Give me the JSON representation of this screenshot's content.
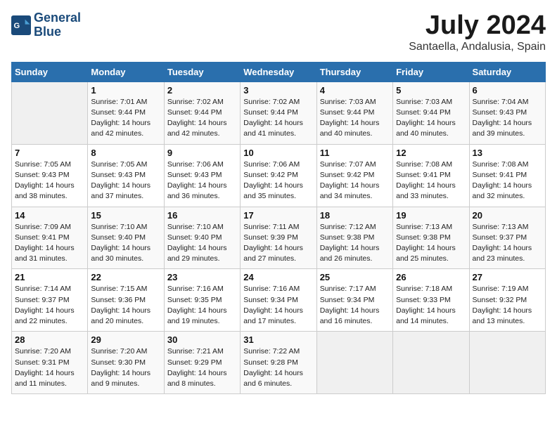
{
  "header": {
    "logo_line1": "General",
    "logo_line2": "Blue",
    "title": "July 2024",
    "subtitle": "Santaella, Andalusia, Spain"
  },
  "days_of_week": [
    "Sunday",
    "Monday",
    "Tuesday",
    "Wednesday",
    "Thursday",
    "Friday",
    "Saturday"
  ],
  "weeks": [
    [
      {
        "num": "",
        "detail": ""
      },
      {
        "num": "1",
        "detail": "Sunrise: 7:01 AM\nSunset: 9:44 PM\nDaylight: 14 hours\nand 42 minutes."
      },
      {
        "num": "2",
        "detail": "Sunrise: 7:02 AM\nSunset: 9:44 PM\nDaylight: 14 hours\nand 42 minutes."
      },
      {
        "num": "3",
        "detail": "Sunrise: 7:02 AM\nSunset: 9:44 PM\nDaylight: 14 hours\nand 41 minutes."
      },
      {
        "num": "4",
        "detail": "Sunrise: 7:03 AM\nSunset: 9:44 PM\nDaylight: 14 hours\nand 40 minutes."
      },
      {
        "num": "5",
        "detail": "Sunrise: 7:03 AM\nSunset: 9:44 PM\nDaylight: 14 hours\nand 40 minutes."
      },
      {
        "num": "6",
        "detail": "Sunrise: 7:04 AM\nSunset: 9:43 PM\nDaylight: 14 hours\nand 39 minutes."
      }
    ],
    [
      {
        "num": "7",
        "detail": "Sunrise: 7:05 AM\nSunset: 9:43 PM\nDaylight: 14 hours\nand 38 minutes."
      },
      {
        "num": "8",
        "detail": "Sunrise: 7:05 AM\nSunset: 9:43 PM\nDaylight: 14 hours\nand 37 minutes."
      },
      {
        "num": "9",
        "detail": "Sunrise: 7:06 AM\nSunset: 9:43 PM\nDaylight: 14 hours\nand 36 minutes."
      },
      {
        "num": "10",
        "detail": "Sunrise: 7:06 AM\nSunset: 9:42 PM\nDaylight: 14 hours\nand 35 minutes."
      },
      {
        "num": "11",
        "detail": "Sunrise: 7:07 AM\nSunset: 9:42 PM\nDaylight: 14 hours\nand 34 minutes."
      },
      {
        "num": "12",
        "detail": "Sunrise: 7:08 AM\nSunset: 9:41 PM\nDaylight: 14 hours\nand 33 minutes."
      },
      {
        "num": "13",
        "detail": "Sunrise: 7:08 AM\nSunset: 9:41 PM\nDaylight: 14 hours\nand 32 minutes."
      }
    ],
    [
      {
        "num": "14",
        "detail": "Sunrise: 7:09 AM\nSunset: 9:41 PM\nDaylight: 14 hours\nand 31 minutes."
      },
      {
        "num": "15",
        "detail": "Sunrise: 7:10 AM\nSunset: 9:40 PM\nDaylight: 14 hours\nand 30 minutes."
      },
      {
        "num": "16",
        "detail": "Sunrise: 7:10 AM\nSunset: 9:40 PM\nDaylight: 14 hours\nand 29 minutes."
      },
      {
        "num": "17",
        "detail": "Sunrise: 7:11 AM\nSunset: 9:39 PM\nDaylight: 14 hours\nand 27 minutes."
      },
      {
        "num": "18",
        "detail": "Sunrise: 7:12 AM\nSunset: 9:38 PM\nDaylight: 14 hours\nand 26 minutes."
      },
      {
        "num": "19",
        "detail": "Sunrise: 7:13 AM\nSunset: 9:38 PM\nDaylight: 14 hours\nand 25 minutes."
      },
      {
        "num": "20",
        "detail": "Sunrise: 7:13 AM\nSunset: 9:37 PM\nDaylight: 14 hours\nand 23 minutes."
      }
    ],
    [
      {
        "num": "21",
        "detail": "Sunrise: 7:14 AM\nSunset: 9:37 PM\nDaylight: 14 hours\nand 22 minutes."
      },
      {
        "num": "22",
        "detail": "Sunrise: 7:15 AM\nSunset: 9:36 PM\nDaylight: 14 hours\nand 20 minutes."
      },
      {
        "num": "23",
        "detail": "Sunrise: 7:16 AM\nSunset: 9:35 PM\nDaylight: 14 hours\nand 19 minutes."
      },
      {
        "num": "24",
        "detail": "Sunrise: 7:16 AM\nSunset: 9:34 PM\nDaylight: 14 hours\nand 17 minutes."
      },
      {
        "num": "25",
        "detail": "Sunrise: 7:17 AM\nSunset: 9:34 PM\nDaylight: 14 hours\nand 16 minutes."
      },
      {
        "num": "26",
        "detail": "Sunrise: 7:18 AM\nSunset: 9:33 PM\nDaylight: 14 hours\nand 14 minutes."
      },
      {
        "num": "27",
        "detail": "Sunrise: 7:19 AM\nSunset: 9:32 PM\nDaylight: 14 hours\nand 13 minutes."
      }
    ],
    [
      {
        "num": "28",
        "detail": "Sunrise: 7:20 AM\nSunset: 9:31 PM\nDaylight: 14 hours\nand 11 minutes."
      },
      {
        "num": "29",
        "detail": "Sunrise: 7:20 AM\nSunset: 9:30 PM\nDaylight: 14 hours\nand 9 minutes."
      },
      {
        "num": "30",
        "detail": "Sunrise: 7:21 AM\nSunset: 9:29 PM\nDaylight: 14 hours\nand 8 minutes."
      },
      {
        "num": "31",
        "detail": "Sunrise: 7:22 AM\nSunset: 9:28 PM\nDaylight: 14 hours\nand 6 minutes."
      },
      {
        "num": "",
        "detail": ""
      },
      {
        "num": "",
        "detail": ""
      },
      {
        "num": "",
        "detail": ""
      }
    ]
  ]
}
